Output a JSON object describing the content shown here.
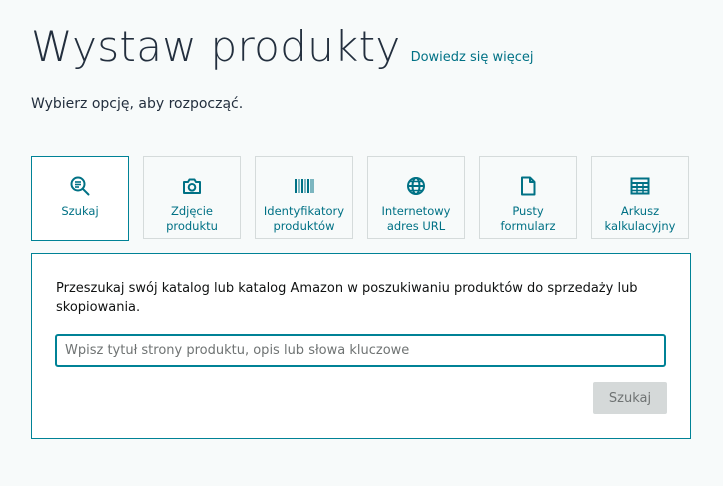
{
  "header": {
    "title": "Wystaw produkty",
    "learn_more": "Dowiedz się więcej",
    "subtitle": "Wybierz opcję, aby rozpocząć."
  },
  "tabs": [
    {
      "label": "Szukaj",
      "icon": "search-list-icon",
      "selected": true
    },
    {
      "label": "Zdjęcie\nproduktu",
      "icon": "camera-icon",
      "selected": false
    },
    {
      "label": "Identyfikatory\nproduktów",
      "icon": "barcode-icon",
      "selected": false
    },
    {
      "label": "Internetowy\nadres URL",
      "icon": "globe-icon",
      "selected": false
    },
    {
      "label": "Pusty\nformularz",
      "icon": "document-icon",
      "selected": false
    },
    {
      "label": "Arkusz\nkalkulacyjny",
      "icon": "spreadsheet-icon",
      "selected": false
    }
  ],
  "panel": {
    "description": "Przeszukaj swój katalog lub katalog Amazon w poszukiwaniu produktów do sprzedaży lub skopiowania.",
    "search_placeholder": "Wpisz tytuł strony produktu, opis lub słowa kluczowe",
    "search_value": "",
    "search_button": "Szukaj",
    "search_button_enabled": false
  },
  "colors": {
    "accent": "#008296",
    "link": "#007185",
    "background": "#f7fafa",
    "title": "#232f3e",
    "disabled_button": "#d5d9d9"
  }
}
